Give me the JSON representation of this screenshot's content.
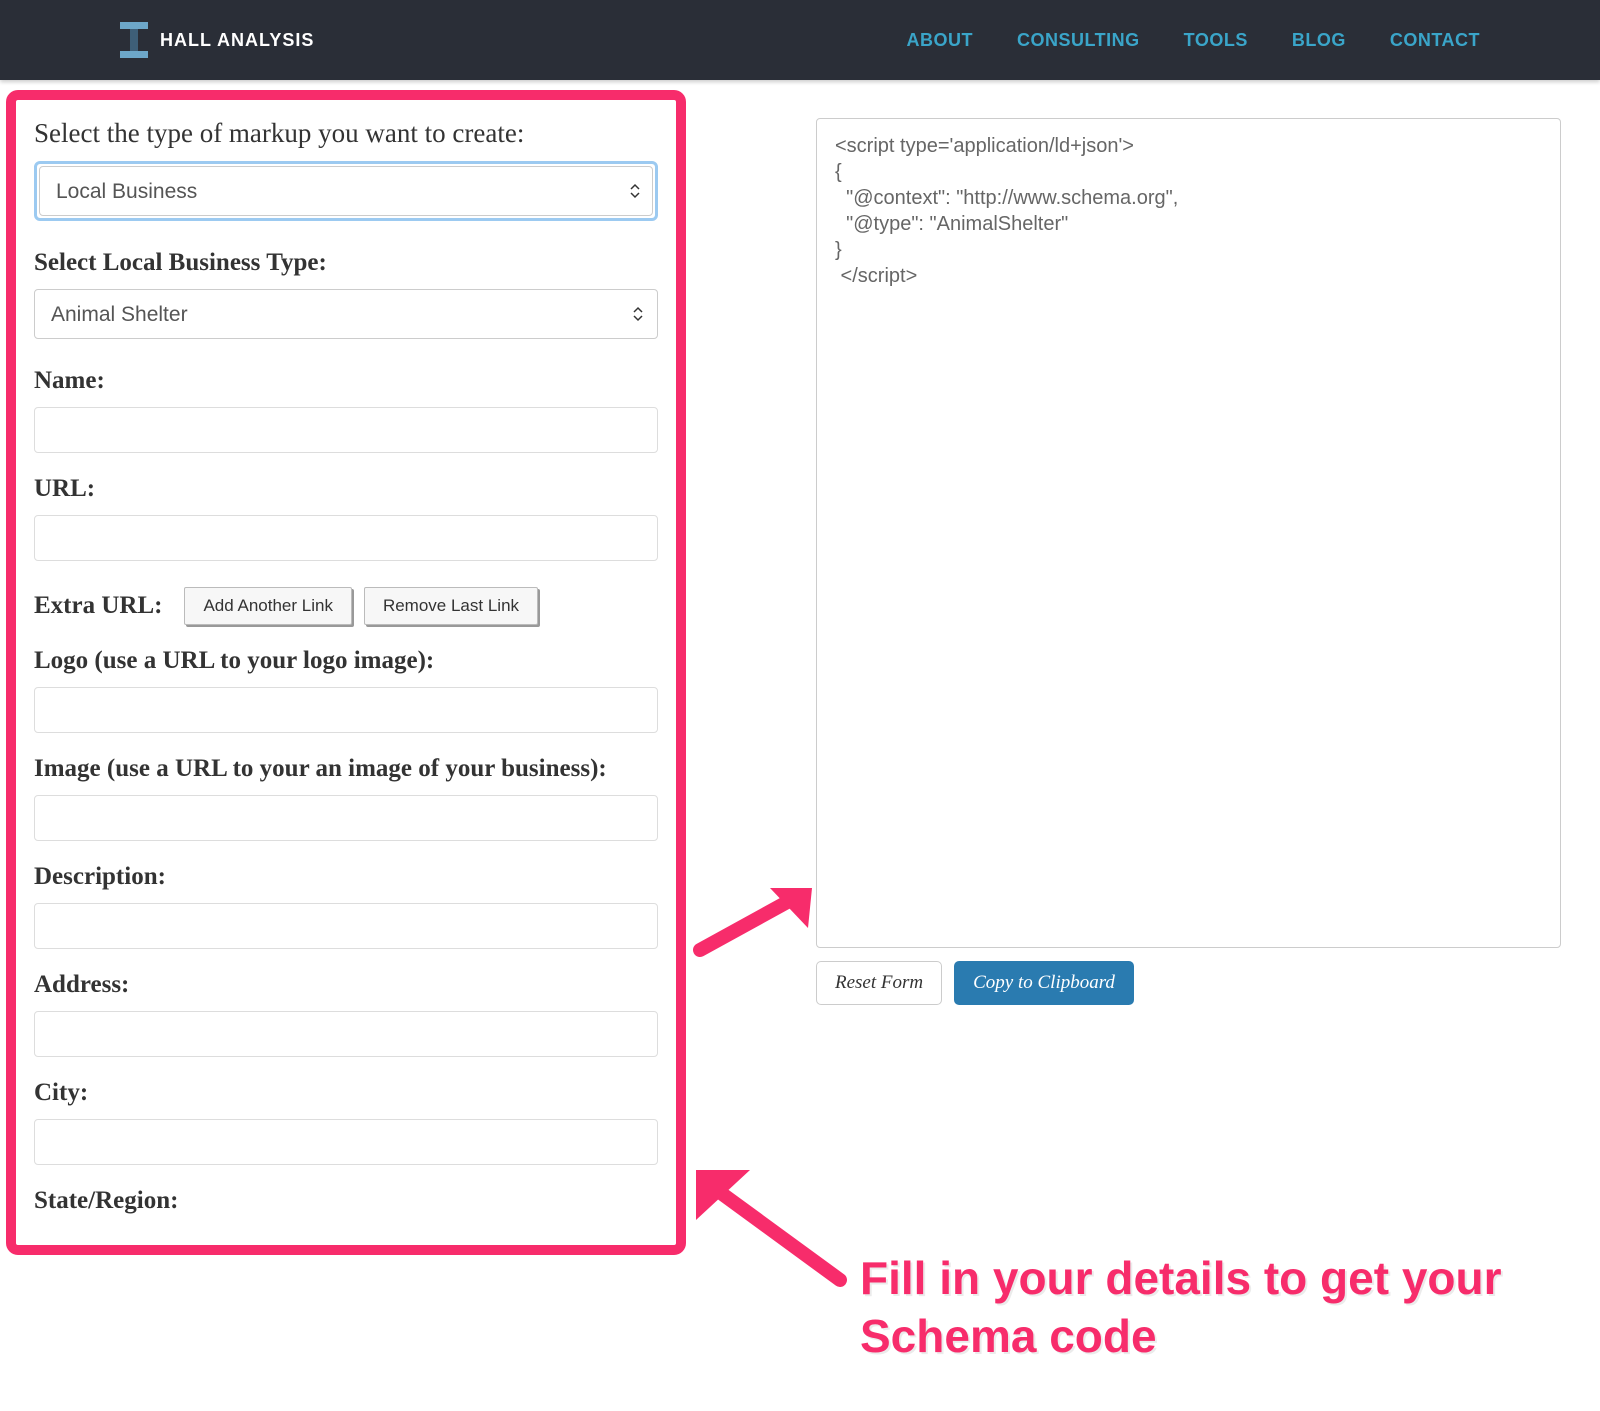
{
  "navbar": {
    "brand": "HALL ANALYSIS",
    "links": [
      "ABOUT",
      "CONSULTING",
      "TOOLS",
      "BLOG",
      "CONTACT"
    ]
  },
  "form": {
    "title": "Select the type of markup you want to create:",
    "markup_type_value": "Local Business",
    "labels": {
      "business_type": "Select Local Business Type:",
      "business_type_value": "Animal Shelter",
      "name": "Name:",
      "url": "URL:",
      "extra_url": "Extra URL:",
      "add_link": "Add Another Link",
      "remove_link": "Remove Last Link",
      "logo": "Logo (use a URL to your logo image):",
      "image": "Image (use a URL to your an image of your business):",
      "description": "Description:",
      "address": "Address:",
      "city": "City:",
      "state": "State/Region:"
    },
    "values": {
      "name": "",
      "url": "",
      "logo": "",
      "image": "",
      "description": "",
      "address": "",
      "city": "",
      "state": ""
    }
  },
  "output": {
    "code": "<script type='application/ld+json'>\n{\n  \"@context\": \"http://www.schema.org\",\n  \"@type\": \"AnimalShelter\"\n}\n </script>",
    "reset_label": "Reset Form",
    "copy_label": "Copy to Clipboard"
  },
  "annotation": "Fill in your details to get your Schema code"
}
